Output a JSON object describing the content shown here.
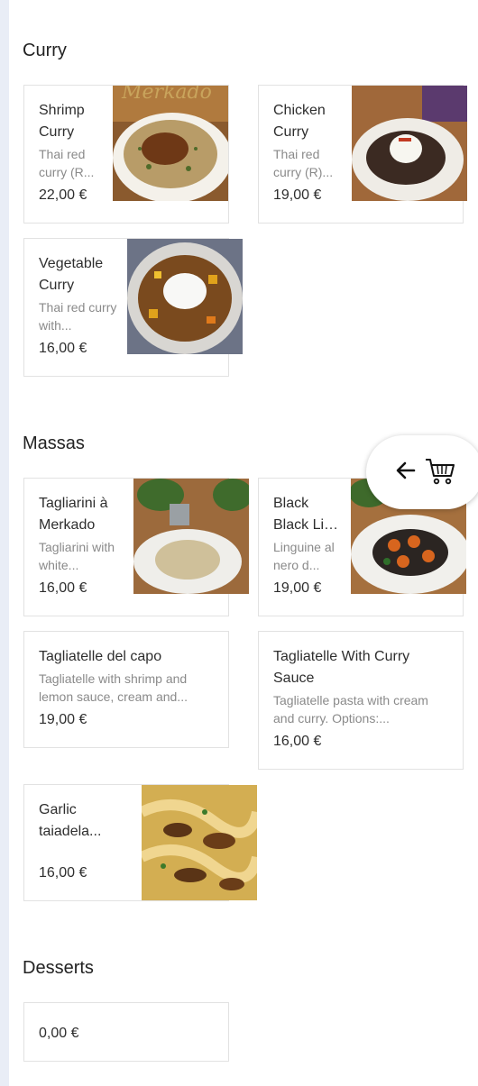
{
  "sections": {
    "curry": {
      "title": "Curry",
      "items": [
        {
          "name": "Shrimp Curry",
          "desc": "Thai red curry (R...",
          "price": "22,00 €"
        },
        {
          "name": "Chicken Curry",
          "desc": "Thai red curry (R)...",
          "price": "19,00 €"
        },
        {
          "name": "Vegetable Curry",
          "desc": "Thai red curry with...",
          "price": "16,00 €"
        }
      ]
    },
    "massas": {
      "title": "Massas",
      "items": [
        {
          "name": "Tagliarini à Merkado",
          "desc": "Tagliarini with white...",
          "price": "16,00 €"
        },
        {
          "name": "Black Lingui...",
          "desc": "Linguine al nero d...",
          "price": "19,00 €"
        },
        {
          "name": "Tagliatelle del capo",
          "desc": "Tagliatelle with shrimp and lemon sauce, cream and...",
          "price": "19,00 €"
        },
        {
          "name": "Tagliatelle With Curry Sauce",
          "desc": "Tagliatelle pasta with cream and curry. Options:...",
          "price": "16,00 €"
        },
        {
          "name": "Garlic taiadela...",
          "price": "16,00 €"
        }
      ]
    },
    "desserts": {
      "title": "Desserts",
      "items": [
        {
          "price": "0,00 €"
        }
      ]
    }
  },
  "cart_button": {
    "icons": [
      "arrow-left-icon",
      "shopping-cart-icon"
    ]
  },
  "colors": {
    "background": "#e9edf6",
    "card_border": "#e2e2e2",
    "muted_text": "#8a8a8a"
  }
}
